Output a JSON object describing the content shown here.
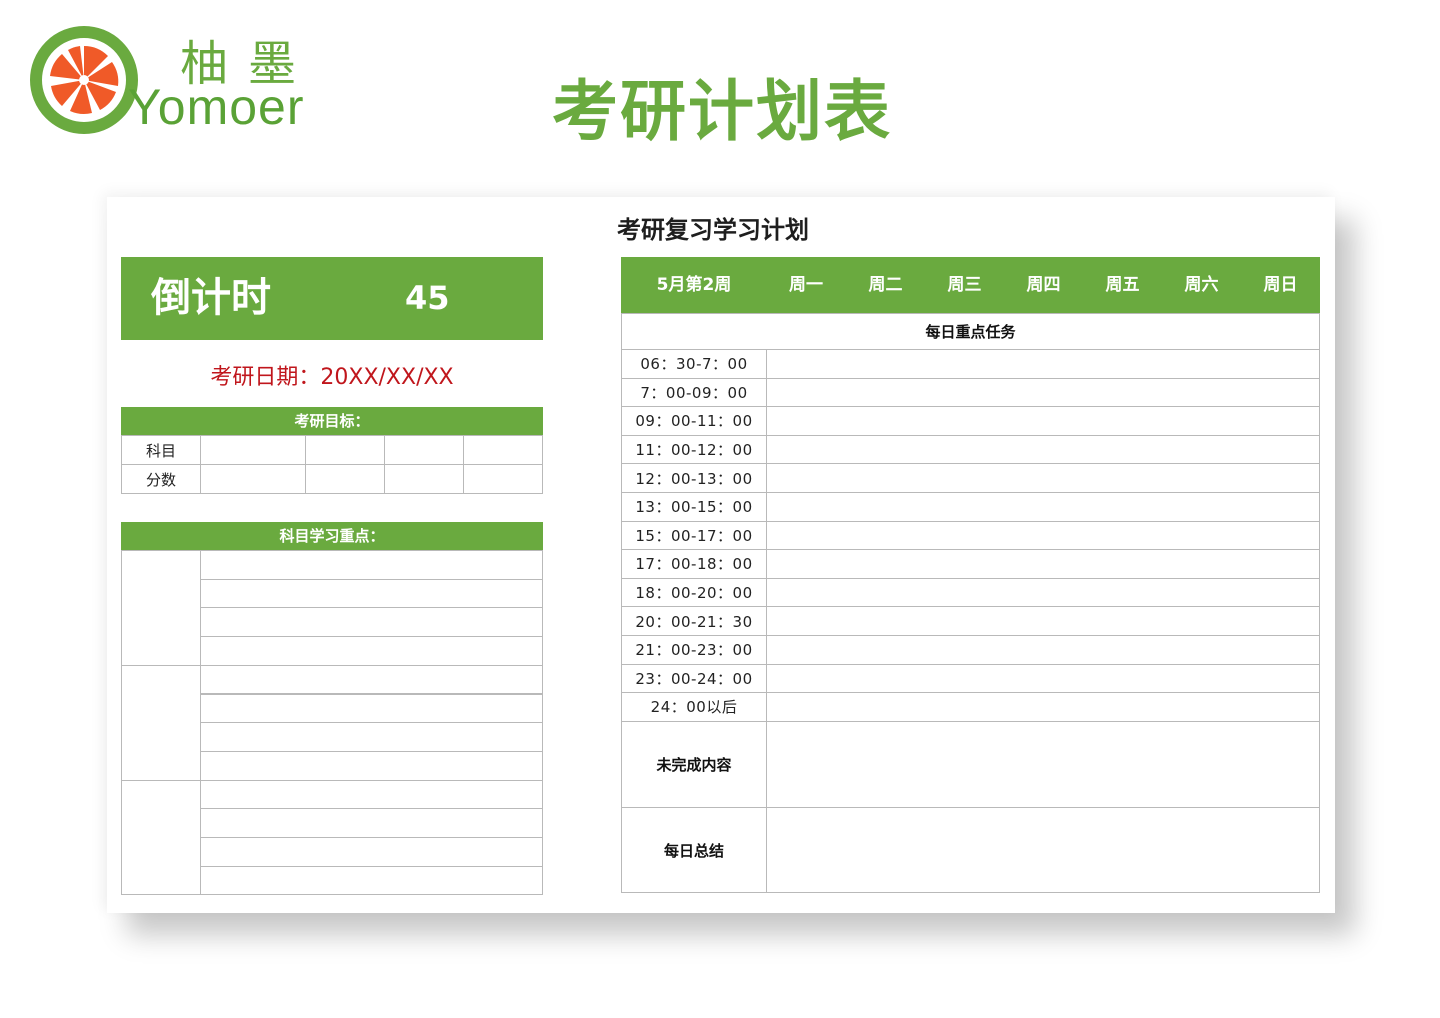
{
  "brand": {
    "name_cn": "柚墨",
    "name_en": "Yomoer",
    "colors": {
      "green": "#6aaa3f",
      "orange": "#f05a28",
      "red": "#c0161c"
    }
  },
  "page_title": "考研计划表",
  "card": {
    "title": "考研复习学习计划",
    "countdown": {
      "label": "倒计时",
      "value": "45"
    },
    "exam_date": "考研日期：20XX/XX/XX",
    "goals": {
      "header": "考研目标：",
      "rows": [
        "科目",
        "分数"
      ]
    },
    "focus": {
      "header": "科目学习重点："
    },
    "schedule": {
      "week_label": "5月第2周",
      "days": [
        "周一",
        "周二",
        "周三",
        "周四",
        "周五",
        "周六",
        "周日"
      ],
      "daily_tasks": "每日重点任务",
      "times": [
        "06：30-7：00",
        "7：00-09：00",
        "09：00-11：00",
        "11：00-12：00",
        "12：00-13：00",
        "13：00-15：00",
        "15：00-17：00",
        "17：00-18：00",
        "18：00-20：00",
        "20：00-21：30",
        "21：00-23：00",
        "23：00-24：00",
        "24：00以后"
      ],
      "unfinished": "未完成内容",
      "summary": "每日总结"
    }
  }
}
